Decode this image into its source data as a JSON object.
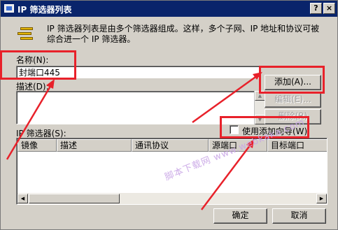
{
  "window": {
    "title": "IP 筛选器列表",
    "help_label": "?",
    "close_label": "×"
  },
  "description": "IP 筛选器列表是由多个筛选器组成。这样，多个子网、IP 地址和协议可被综合进一个 IP 筛选器。",
  "name_field": {
    "label": "名称(N):",
    "value": "封端口445"
  },
  "description_field": {
    "label": "描述(D):",
    "value": ""
  },
  "buttons": {
    "add": "添加(A)...",
    "edit": "编辑(E)...",
    "remove": "删除(R)",
    "ok": "确定",
    "cancel": "取消"
  },
  "filter_section": {
    "label": "IP 筛选器(S):",
    "wizard_label": "使用添加向导(W)",
    "wizard_checked": false,
    "columns": [
      "镜像",
      "描述",
      "通讯协议",
      "源端口",
      "目标端口"
    ],
    "rows": []
  },
  "watermark": "脚本下载网 www.webkaka.com",
  "colors": {
    "titlebar": "#09246b",
    "dialog_bg": "#d4d0c8",
    "annotation_red": "#e8212a"
  }
}
